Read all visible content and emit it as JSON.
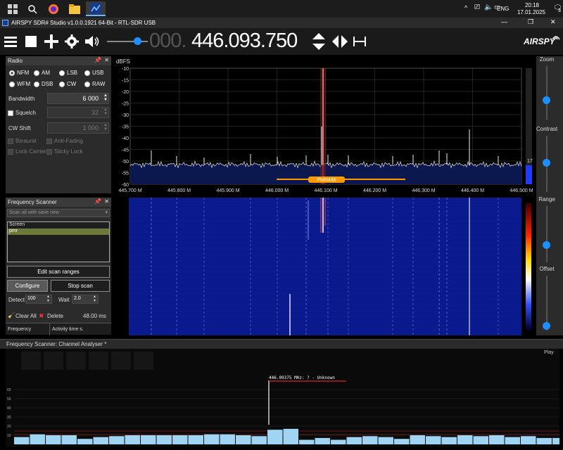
{
  "taskbar": {
    "time": "20:18",
    "date": "17.01.2025",
    "lang": "ENG",
    "chevron": "^",
    "notif_count": "3"
  },
  "window": {
    "title": "AIRSPY SDR# Studio v1.0.0.1921 64-Bit - RTL-SDR USB",
    "min": "—",
    "max": "❐",
    "close": "✕"
  },
  "toolbar": {
    "freq_dim": "000.",
    "freq_main": "446.093.750",
    "brand": "AIRSPY"
  },
  "radio": {
    "title": "Radio",
    "modes": [
      "NFM",
      "AM",
      "LSB",
      "USB",
      "WFM",
      "DSB",
      "CW",
      "RAW"
    ],
    "selected_mode": "NFM",
    "bandwidth_label": "Bandwidth",
    "bandwidth_value": "6 000",
    "squelch_label": "Squelch",
    "squelch_value": "32",
    "cwshift_label": "CW Shift",
    "cwshift_value": "1 000",
    "binaural": "Binaural",
    "antifading": "Anti-Fading",
    "lockcarrier": "Lock Carrier",
    "stickylock": "Sticky Lock"
  },
  "scanner": {
    "title": "Frequency Scanner",
    "mode_select": "Scan all with save new",
    "list": [
      "Screen",
      "pmr"
    ],
    "selected": "pmr",
    "edit_ranges": "Edit scan ranges",
    "configure": "Configure",
    "stop": "Stop scan",
    "detect_label": "Detect",
    "detect_value": "100",
    "wait_label": "Wait",
    "wait_value": "2.0",
    "clear_all": "Clear All",
    "delete": "Delete",
    "ms_value": "48.00 ms",
    "col_freq": "Frequency",
    "col_activity": "Activity time s."
  },
  "spectrum": {
    "unit": "dBFS",
    "y_ticks": [
      "-10",
      "-15",
      "-20",
      "-25",
      "-30",
      "-35",
      "-40",
      "-45",
      "-50",
      "-55",
      "-60"
    ],
    "x_ticks": [
      "445.700 M",
      "445.800 M",
      "445.900 M",
      "446.000 M",
      "446.100 M",
      "446.200 M",
      "446.300 M",
      "446.400 M",
      "446.500 M"
    ],
    "band_label": "PMR446",
    "level_value": "17"
  },
  "sliders": {
    "zoom": "Zoom",
    "contrast": "Contrast",
    "range": "Range",
    "offset": "Offset",
    "zoom_level": 0.6,
    "contrast_level": 0.55,
    "range_level": 0.3,
    "offset_level": 0.05
  },
  "analyser": {
    "title": "Frequency Scanner: Channel Analyser *",
    "play": "Play",
    "marker_text": "446.09375 MHz: ? - Unknown",
    "y_ticks": [
      "60",
      "50",
      "40",
      "30",
      "20",
      "10"
    ]
  },
  "colors": {
    "accent": "#1e8fff",
    "waterfall": "#0a1a8c",
    "band": "#ff9900",
    "bar": "#9fd4f2"
  }
}
